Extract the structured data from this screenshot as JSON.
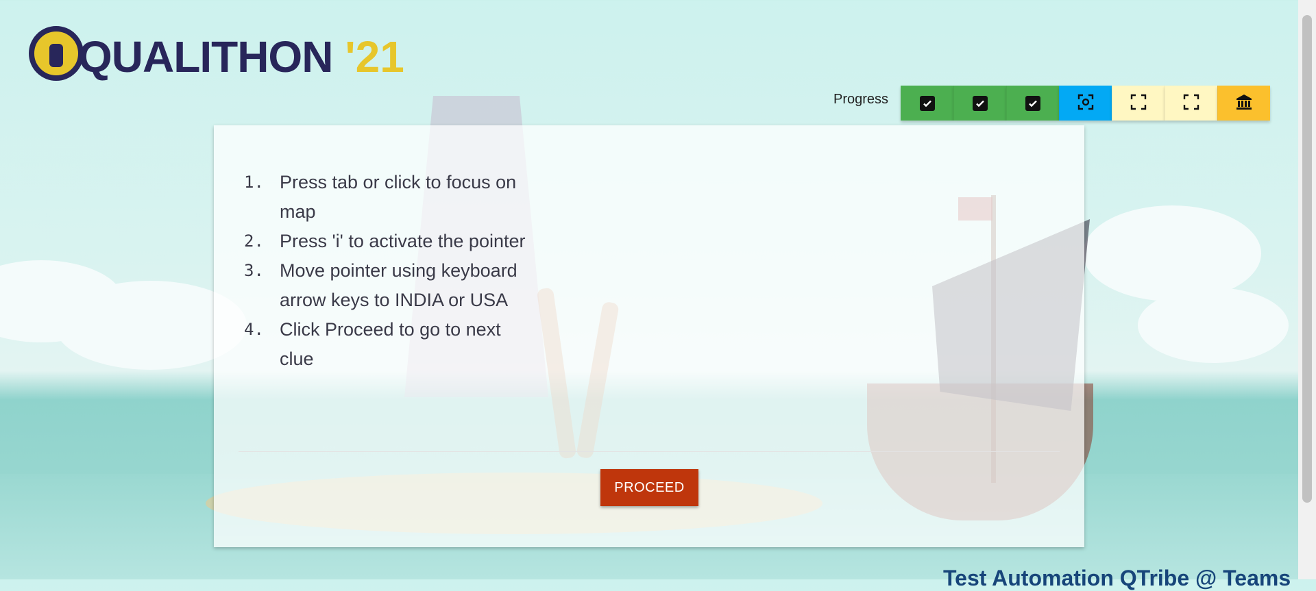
{
  "logo": {
    "text": "QUALITHON",
    "year": "'21"
  },
  "progress": {
    "label": "Progress",
    "steps": [
      {
        "state": "done",
        "icon": "check-icon"
      },
      {
        "state": "done",
        "icon": "check-icon"
      },
      {
        "state": "done",
        "icon": "check-icon"
      },
      {
        "state": "current",
        "icon": "focus-icon"
      },
      {
        "state": "pending",
        "icon": "frame-icon"
      },
      {
        "state": "pending",
        "icon": "frame-icon"
      },
      {
        "state": "final",
        "icon": "bank-icon"
      }
    ],
    "colors": {
      "done": "#4caf50",
      "current": "#03a9f4",
      "pending": "#fff7c2",
      "final": "#fbc02d"
    }
  },
  "instructions": [
    {
      "number": "1.",
      "text": "Press tab or click to focus on map"
    },
    {
      "number": "2.",
      "text": "Press 'i' to activate the pointer"
    },
    {
      "number": "3.",
      "text": "Move pointer using keyboard arrow keys to INDIA or USA"
    },
    {
      "number": "4.",
      "text": "Click Proceed to go to next clue"
    }
  ],
  "proceed_button": {
    "label": "PROCEED",
    "color": "#bf360c"
  },
  "footer": {
    "text": "Test Automation QTribe @ Teams"
  }
}
